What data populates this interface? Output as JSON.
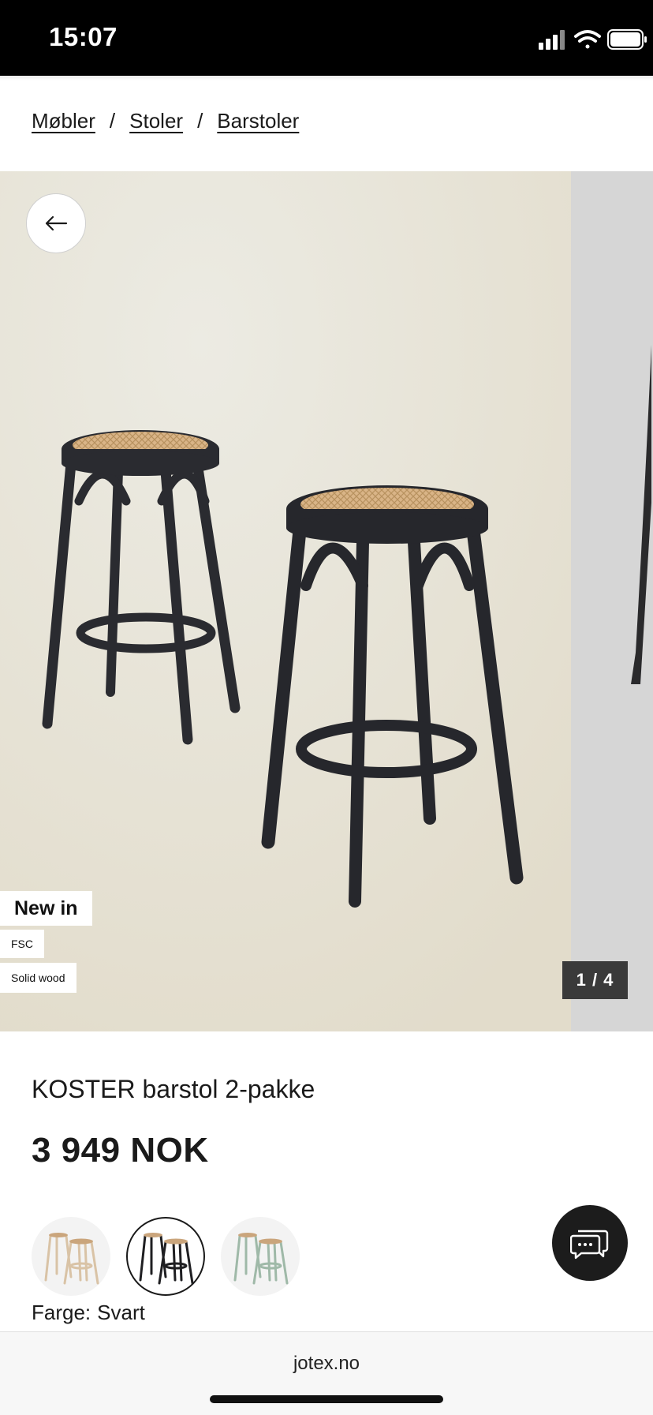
{
  "status_bar": {
    "time": "15:07"
  },
  "breadcrumb": {
    "items": [
      "Møbler",
      "Stoler",
      "Barstoler"
    ],
    "separator": "/"
  },
  "gallery": {
    "counter": "1 / 4",
    "tags": {
      "new": "New in",
      "fsc": "FSC",
      "material": "Solid wood"
    }
  },
  "product": {
    "title": "KOSTER barstol 2-pakke",
    "price": "3 949 NOK"
  },
  "color": {
    "label": "Farge:",
    "value": "Svart",
    "swatches": [
      {
        "name": "natural",
        "hex": "#d9c3a6",
        "selected": false
      },
      {
        "name": "black",
        "hex": "#1f1f22",
        "selected": true
      },
      {
        "name": "green",
        "hex": "#9fb9a8",
        "selected": false
      }
    ]
  },
  "browser": {
    "url": "jotex.no"
  },
  "icons": {
    "back": "arrow-left-icon",
    "chat": "chat-icon"
  }
}
